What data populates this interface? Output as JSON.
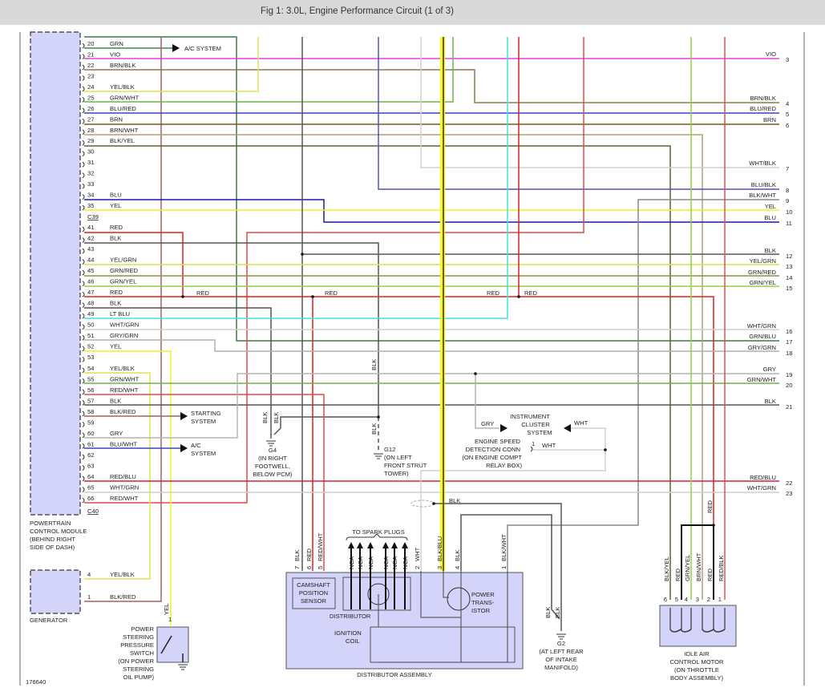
{
  "header": {
    "title": "Fig 1: 3.0L, Engine Performance Circuit (1 of 3)"
  },
  "colors": {
    "GRN": "#3a8a4a",
    "VIO": "#e040e0",
    "BRN/BLK": "#8a7a50",
    "YEL/BLK": "#e0e050",
    "GRN/WHT": "#70b050",
    "BLU/RED": "#4040c0",
    "BRN": "#7a5a20",
    "BRN/WHT": "#b0a070",
    "BLK/YEL": "#606030",
    "BLU": "#1a1aa0",
    "YEL": "#f0f020",
    "RED": "#e02020",
    "BLK": "#555555",
    "YEL/GRN": "#d8e040",
    "GRN/RED": "#8a9040",
    "GRN/YEL": "#90d040",
    "LT BLU": "#40e0e8",
    "WHT/GRN": "#c8d4c8",
    "GRY/GRN": "#a8b4a8",
    "RED/WHT": "#e04848",
    "BLK/RED": "#a86060",
    "GRY": "#b4b4b4",
    "BLU/WHT": "#4040c0",
    "RED/BLU": "#d02040",
    "GRN/BLU": "#3a7a4a",
    "WHT/BLK": "#d0d0d0",
    "BLU/BLK": "#5050c0",
    "BLK/WHT": "#888888",
    "WHT": "#d0d0d0",
    "RED/BLK": "#e05050",
    "BLK/BLU": "#333333",
    "highlight": "#f8f820",
    "component_fill": "#d4d4fa"
  },
  "pcm": {
    "pins": [
      {
        "num": "20",
        "wire": "GRN"
      },
      {
        "num": "21",
        "wire": "VIO"
      },
      {
        "num": "22",
        "wire": "BRN/BLK"
      },
      {
        "num": "23",
        "wire": ""
      },
      {
        "num": "24",
        "wire": "YEL/BLK"
      },
      {
        "num": "25",
        "wire": "GRN/WHT"
      },
      {
        "num": "26",
        "wire": "BLU/RED"
      },
      {
        "num": "27",
        "wire": "BRN"
      },
      {
        "num": "28",
        "wire": "BRN/WHT"
      },
      {
        "num": "29",
        "wire": "BLK/YEL"
      },
      {
        "num": "30",
        "wire": ""
      },
      {
        "num": "31",
        "wire": ""
      },
      {
        "num": "32",
        "wire": ""
      },
      {
        "num": "33",
        "wire": ""
      },
      {
        "num": "34",
        "wire": "BLU"
      },
      {
        "num": "35",
        "wire": "YEL"
      },
      {
        "num": "41",
        "wire": "RED"
      },
      {
        "num": "42",
        "wire": "BLK"
      },
      {
        "num": "43",
        "wire": ""
      },
      {
        "num": "44",
        "wire": "YEL/GRN"
      },
      {
        "num": "45",
        "wire": "GRN/RED"
      },
      {
        "num": "46",
        "wire": "GRN/YEL"
      },
      {
        "num": "47",
        "wire": "RED"
      },
      {
        "num": "48",
        "wire": "BLK"
      },
      {
        "num": "49",
        "wire": "LT BLU"
      },
      {
        "num": "50",
        "wire": "WHT/GRN"
      },
      {
        "num": "51",
        "wire": "GRY/GRN"
      },
      {
        "num": "52",
        "wire": "YEL"
      },
      {
        "num": "53",
        "wire": ""
      },
      {
        "num": "54",
        "wire": "YEL/BLK"
      },
      {
        "num": "55",
        "wire": "GRN/WHT"
      },
      {
        "num": "56",
        "wire": "RED/WHT"
      },
      {
        "num": "57",
        "wire": "BLK"
      },
      {
        "num": "58",
        "wire": "BLK/RED"
      },
      {
        "num": "59",
        "wire": ""
      },
      {
        "num": "60",
        "wire": "GRY"
      },
      {
        "num": "61",
        "wire": "BLU/WHT"
      },
      {
        "num": "62",
        "wire": ""
      },
      {
        "num": "63",
        "wire": ""
      },
      {
        "num": "64",
        "wire": "RED/BLU"
      },
      {
        "num": "65",
        "wire": "WHT/GRN"
      },
      {
        "num": "66",
        "wire": "RED/WHT"
      }
    ],
    "connector_c39": "C39",
    "connector_c40": "C40",
    "name_lines": [
      "POWERTRAIN",
      "CONTROL MODULE",
      "(BEHIND RIGHT",
      "SIDE OF DASH)"
    ]
  },
  "generator": {
    "name": "GENERATOR",
    "pins": [
      {
        "num": "4",
        "wire": "YEL/BLK"
      },
      {
        "num": "1",
        "wire": "BLK/RED"
      }
    ]
  },
  "right_connectors": [
    {
      "num": "3",
      "wire": "VIO"
    },
    {
      "num": "4",
      "wire": "BRN/BLK"
    },
    {
      "num": "5",
      "wire": "BLU/RED"
    },
    {
      "num": "6",
      "wire": "BRN"
    },
    {
      "num": "7",
      "wire": "WHT/BLK"
    },
    {
      "num": "8",
      "wire": "BLU/BLK"
    },
    {
      "num": "9",
      "wire": "BLK/WHT"
    },
    {
      "num": "10",
      "wire": "YEL"
    },
    {
      "num": "11",
      "wire": "BLU"
    },
    {
      "num": "12",
      "wire": "BLK"
    },
    {
      "num": "13",
      "wire": "YEL/GRN"
    },
    {
      "num": "14",
      "wire": "GRN/RED"
    },
    {
      "num": "15",
      "wire": "GRN/YEL"
    },
    {
      "num": "16",
      "wire": "WHT/GRN"
    },
    {
      "num": "17",
      "wire": "GRN/BLU"
    },
    {
      "num": "18",
      "wire": "GRY/GRN"
    },
    {
      "num": "19",
      "wire": "GRY"
    },
    {
      "num": "20",
      "wire": "GRN/WHT"
    },
    {
      "num": "21",
      "wire": "BLK"
    },
    {
      "num": "22",
      "wire": "RED/BLU"
    },
    {
      "num": "23",
      "wire": "WHT/GRN"
    }
  ],
  "systems": {
    "ac_top": "A/C SYSTEM",
    "starting": [
      "STARTING",
      "SYSTEM"
    ],
    "ac_bottom": [
      "A/C",
      "SYSTEM"
    ],
    "instrument": [
      "INSTRUMENT",
      "CLUSTER",
      "SYSTEM"
    ]
  },
  "splice_labels": {
    "red1": "RED",
    "red2": "RED",
    "red3": "RED",
    "red4": "RED"
  },
  "grounds": {
    "g4": {
      "wires": [
        "BLK",
        "BLK"
      ],
      "lines": [
        "G4",
        "(IN RIGHT",
        "FOOTWELL,",
        "BELOW PCM)"
      ]
    },
    "g12": {
      "wires": [
        "BLK",
        "BLK"
      ],
      "lines": [
        "G12",
        "(ON LEFT",
        "FRONT STRUT",
        "TOWER)"
      ]
    },
    "g2": {
      "wires": [
        "BLK",
        "BLK"
      ],
      "lines": [
        "G2",
        "(AT LEFT REAR",
        "OF INTAKE",
        "MANIFOLD)"
      ]
    }
  },
  "engine_speed": {
    "pin": "1",
    "wire_in": "GRY",
    "wire_out": "WHT",
    "wire_conn": "WHT",
    "lines": [
      "ENGINE SPEED",
      "DETECTION CONN",
      "(ON ENGINE COMPT",
      "RELAY BOX)"
    ]
  },
  "distributor_assembly": {
    "title": "DISTRIBUTOR ASSEMBLY",
    "to_spark_plugs": "TO SPARK PLUGS",
    "nca": [
      "NCA",
      "NCA",
      "NCA",
      "NCA",
      "NCA",
      "NCA"
    ],
    "pins": [
      {
        "num": "7",
        "wire": "BLK"
      },
      {
        "num": "6",
        "wire": "RED"
      },
      {
        "num": "5",
        "wire": "RED/WHT"
      },
      {
        "num": "2",
        "wire": "WHT"
      },
      {
        "num": "3",
        "wire": "BLK/BLU"
      },
      {
        "num": "4",
        "wire": "BLK"
      },
      {
        "num": "1",
        "wire": "BLK/WHT"
      }
    ],
    "camshaft": [
      "CAMSHAFT",
      "POSITION",
      "SENSOR"
    ],
    "distributor": "DISTRIBUTOR",
    "transistor": [
      "POWER",
      "TRANS-",
      "ISTOR"
    ],
    "coil": [
      "IGNITION",
      "COIL"
    ],
    "shield_wire": "BLK"
  },
  "iac": {
    "pins": [
      {
        "num": "6",
        "wire": "BLK/YEL"
      },
      {
        "num": "5",
        "wire": "RED"
      },
      {
        "num": "4",
        "wire": "GRN/YEL"
      },
      {
        "num": "3",
        "wire": "BRN/WHT"
      },
      {
        "num": "2",
        "wire": "RED"
      },
      {
        "num": "1",
        "wire": "RED/BLK"
      }
    ],
    "red_feed": "RED",
    "lines": [
      "IDLE AIR",
      "CONTROL MOTOR",
      "(ON THROTTLE",
      "BODY ASSEMBLY)"
    ]
  },
  "ps_switch": {
    "pin": "1",
    "wire": "YEL",
    "lines": [
      "POWER",
      "STEERING",
      "PRESSURE",
      "SWITCH",
      "(ON POWER",
      "STEERING",
      "OIL PUMP)"
    ]
  },
  "figure_id": "176640"
}
